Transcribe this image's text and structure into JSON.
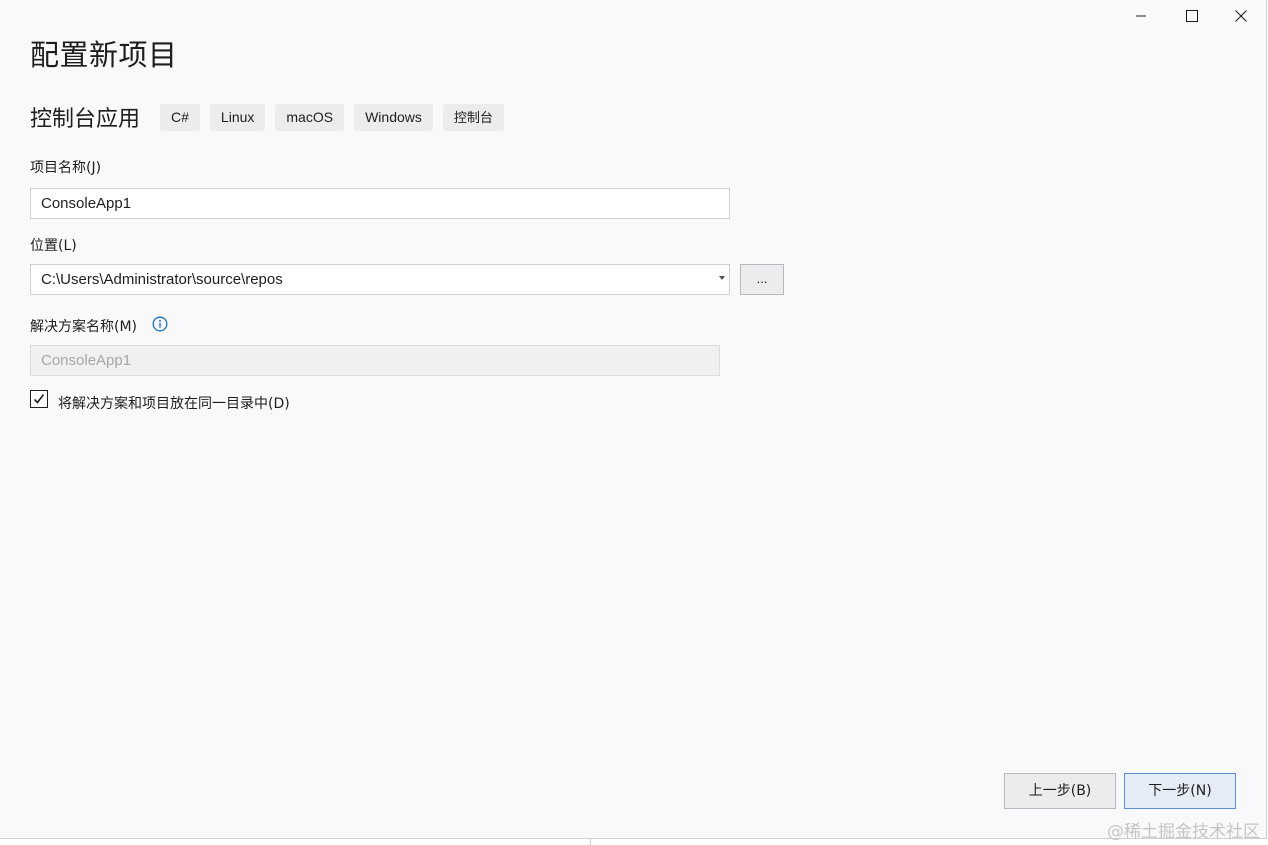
{
  "dialog": {
    "title": "配置新项目",
    "template_name": "控制台应用",
    "tags": [
      "C#",
      "Linux",
      "macOS",
      "Windows",
      "控制台"
    ]
  },
  "fields": {
    "project_name_label": "项目名称(J)",
    "project_name_value": "ConsoleApp1",
    "location_label": "位置(L)",
    "location_value": "C:\\Users\\Administrator\\source\\repos",
    "browse_label": "...",
    "solution_name_label": "解决方案名称(M)",
    "solution_name_value": "ConsoleApp1"
  },
  "options": {
    "same_directory_label": "将解决方案和项目放在同一目录中(D)",
    "same_directory_checked": true
  },
  "footer": {
    "back_label": "上一步(B)",
    "next_label": "下一步(N)"
  },
  "watermark": "@稀土掘金技术社区",
  "icons": {
    "minimize": "minimize-icon",
    "maximize": "maximize-icon",
    "close": "close-icon",
    "info": "info-icon",
    "dropdown": "chevron-down-icon",
    "check": "checkmark-icon"
  },
  "colors": {
    "background": "#f9f9fb",
    "tag_background": "#ececef",
    "info_accent": "#1a73b8",
    "primary_border": "#5a8fcf"
  }
}
